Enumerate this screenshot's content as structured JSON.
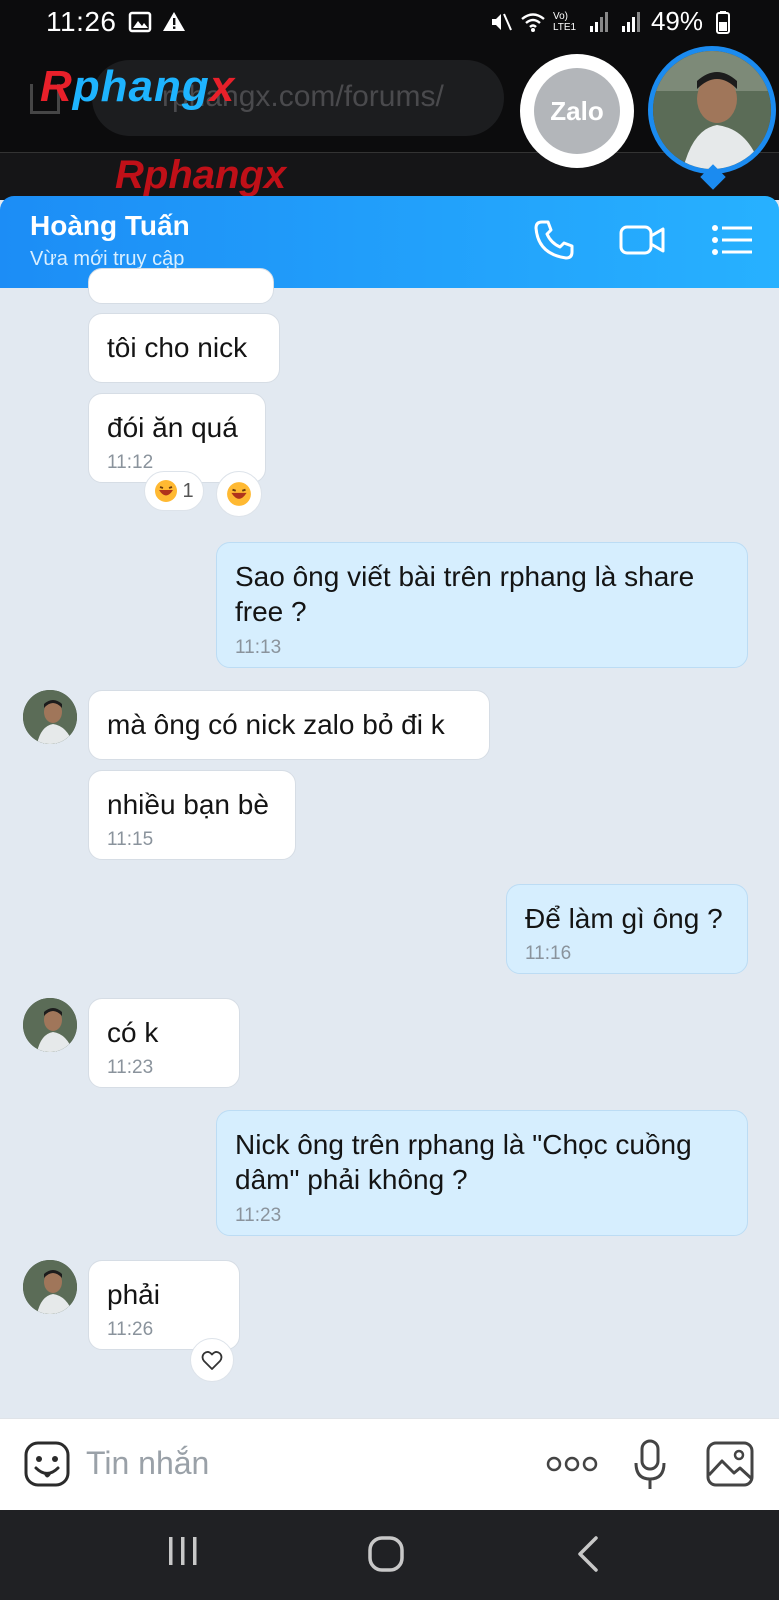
{
  "status_bar": {
    "time": "11:26",
    "network_label": "Vo) LTE1",
    "battery_percent": "49%"
  },
  "browser": {
    "logo": "Rphangx",
    "url": "rphangx.com/forums/"
  },
  "bubble_heads": {
    "zalo_label": "Zalo"
  },
  "chat_header": {
    "contact_name": "Hoàng Tuấn",
    "contact_status": "Vừa mới truy cập"
  },
  "messages": [
    {
      "side": "in",
      "text": "tôi cho nick",
      "time": ""
    },
    {
      "side": "in",
      "text": "đói ăn quá",
      "time": "11:12",
      "reaction_count": "1"
    },
    {
      "side": "out",
      "line1": "Sao ông viết bài trên rphang là share",
      "line2": "free ?",
      "time": "11:13"
    },
    {
      "side": "in",
      "text": "mà ông có nick zalo bỏ đi k",
      "time": ""
    },
    {
      "side": "in",
      "text": "nhiều bạn bè",
      "time": "11:15"
    },
    {
      "side": "out",
      "text": "Để làm gì ông ?",
      "time": "11:16"
    },
    {
      "side": "in",
      "text": "có k",
      "time": "11:23"
    },
    {
      "side": "out",
      "line1": "Nick ông trên rphang là \"Chọc cuồng",
      "line2": "dâm\" phải không ?",
      "time": "11:23"
    },
    {
      "side": "in",
      "text": "phải",
      "time": "11:26"
    }
  ],
  "input": {
    "placeholder": "Tin nhắn"
  },
  "colors": {
    "header_start": "#1c8df6",
    "header_end": "#27b1ff",
    "outgoing_bubble": "#d6eefe",
    "incoming_bubble": "#ffffff",
    "chat_background": "#e2e9f1"
  }
}
